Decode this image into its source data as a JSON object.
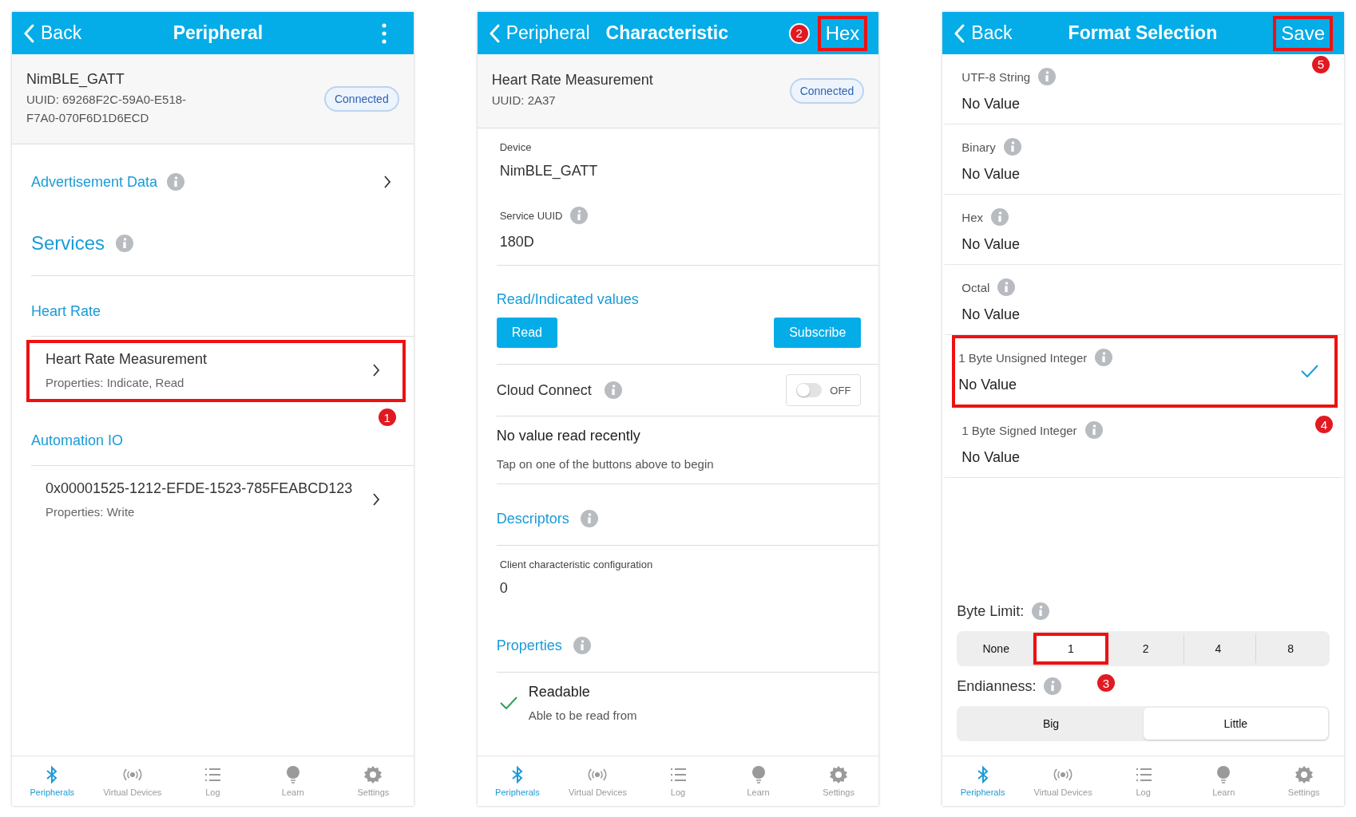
{
  "peripheral_screen": {
    "header": {
      "back": "Back",
      "title": "Peripheral"
    },
    "device": {
      "name": "NimBLE_GATT",
      "uuid": "UUID: 69268F2C-59A0-E518-F7A0-070F6D1D6ECD",
      "status": "Connected"
    },
    "advertisement_data": "Advertisement Data",
    "services_heading": "Services",
    "services": [
      {
        "name": "Heart Rate",
        "characteristics": [
          {
            "name": "Heart Rate Measurement",
            "properties": "Properties: Indicate, Read",
            "annotation": "1"
          }
        ]
      },
      {
        "name": "Automation IO",
        "characteristics": [
          {
            "name": "0x00001525-1212-EFDE-1523-785FEABCD123",
            "properties": "Properties: Write"
          }
        ]
      }
    ],
    "tab_bar": [
      {
        "label": "Peripherals",
        "selected": true
      },
      {
        "label": "Virtual Devices",
        "selected": false
      },
      {
        "label": "Log",
        "selected": false
      },
      {
        "label": "Learn",
        "selected": false
      },
      {
        "label": "Settings",
        "selected": false
      }
    ]
  },
  "characteristic_screen": {
    "header": {
      "back": "Peripheral",
      "title": "Characteristic",
      "action": "Hex",
      "action_annotation": "2"
    },
    "characteristic": {
      "name": "Heart Rate Measurement",
      "uuid": "UUID: 2A37",
      "status": "Connected"
    },
    "device_label": "Device",
    "device_value": "NimBLE_GATT",
    "service_uuid_label": "Service UUID",
    "service_uuid_value": "180D",
    "values_heading": "Read/Indicated values",
    "buttons": [
      "Read",
      "Subscribe"
    ],
    "cloud_connect": {
      "label": "Cloud Connect",
      "on": false,
      "state_label": "OFF"
    },
    "empty_title": "No value read recently",
    "empty_hint": "Tap on one of the buttons above to begin",
    "descriptors_heading": "Descriptors",
    "descriptor_label": "Client characteristic configuration",
    "descriptor_value": "0",
    "properties_heading": "Properties",
    "properties": [
      {
        "name": "Readable",
        "description": "Able to be read from",
        "checked": true
      }
    ],
    "tab_bar": [
      {
        "label": "Peripherals",
        "selected": true
      },
      {
        "label": "Virtual Devices",
        "selected": false
      },
      {
        "label": "Log",
        "selected": false
      },
      {
        "label": "Learn",
        "selected": false
      },
      {
        "label": "Settings",
        "selected": false
      }
    ]
  },
  "format_screen": {
    "header": {
      "back": "Back",
      "title": "Format Selection",
      "action": "Save",
      "action_annotation": "5"
    },
    "formats": [
      {
        "name": "UTF-8 String",
        "value": "No Value",
        "selected": false
      },
      {
        "name": "Binary",
        "value": "No Value",
        "selected": false
      },
      {
        "name": "Hex",
        "value": "No Value",
        "selected": false
      },
      {
        "name": "Octal",
        "value": "No Value",
        "selected": false
      },
      {
        "name": "1 Byte Unsigned Integer",
        "value": "No Value",
        "selected": true,
        "annotation": "4"
      },
      {
        "name": "1 Byte Signed Integer",
        "value": "No Value",
        "selected": false
      }
    ],
    "byte_limit": {
      "label": "Byte Limit:",
      "options": [
        {
          "label": "None",
          "selected": false
        },
        {
          "label": "1",
          "selected": true,
          "annotation": "3"
        },
        {
          "label": "2",
          "selected": false
        },
        {
          "label": "4",
          "selected": false
        },
        {
          "label": "8",
          "selected": false
        }
      ]
    },
    "endianness": {
      "label": "Endianness:",
      "options": [
        {
          "label": "Big",
          "selected": false
        },
        {
          "label": "Little",
          "selected": true
        }
      ]
    },
    "tab_bar": [
      {
        "label": "Peripherals",
        "selected": true
      },
      {
        "label": "Virtual Devices",
        "selected": false
      },
      {
        "label": "Log",
        "selected": false
      },
      {
        "label": "Learn",
        "selected": false
      },
      {
        "label": "Settings",
        "selected": false
      }
    ]
  }
}
